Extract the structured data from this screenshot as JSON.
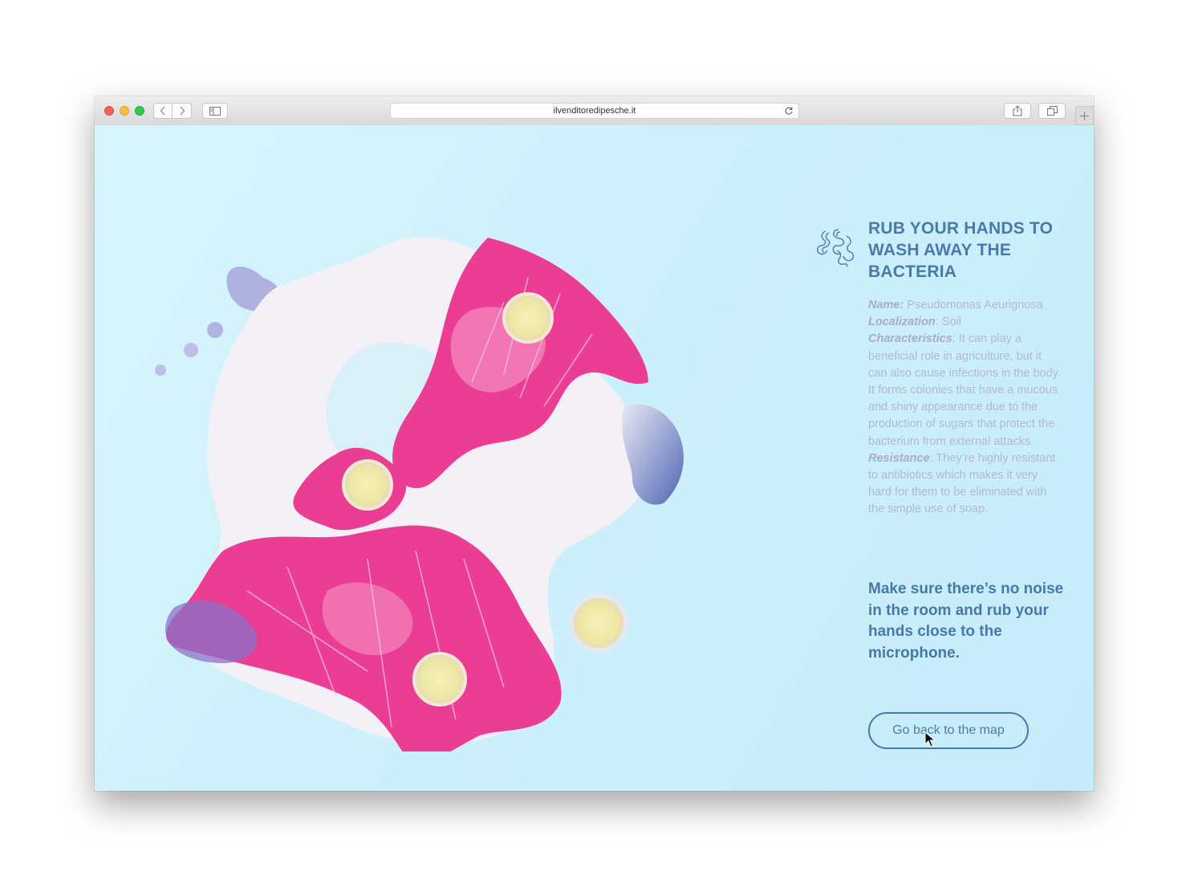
{
  "browser": {
    "url": "ilvenditoredipesche.it"
  },
  "page": {
    "title": "RUB YOUR HANDS TO WASH AWAY THE BACTERIA",
    "info": {
      "name_label": "Name:",
      "name_value": " Pseudomonas Aeurignosa",
      "localization_label": "Localization",
      "localization_value": ": Soil",
      "characteristics_label": "Characteristics",
      "characteristics_value": ": It can play a beneficial role in agriculture, but it can also cause infections in the body. It forms colonies that have a mucous and shiny appearance due to the production of sugars that protect the bacterium from external attacks.",
      "resistance_label": "Resistance",
      "resistance_value": ": They’re highly resistant to antibiotics which makes it very hard for them to be eliminated with the simple use of soap."
    },
    "instruction": "Make sure there’s no noise in the room and rub your hands close to the microphone.",
    "back_button_label": "Go back to the map"
  },
  "colors": {
    "background": "#cdeffa",
    "heading": "#4a7aa8",
    "body_text": "#b4b9c8",
    "bacteria_pink": "#ec3d94",
    "bacteria_white": "#f3f1f6",
    "bacteria_purple": "#a8a4d8"
  },
  "icons": {
    "bacteria": "bacteria-icon",
    "back": "chevron-left-icon",
    "forward": "chevron-right-icon",
    "sidebar": "sidebar-icon",
    "share": "share-icon",
    "tabs": "tabs-icon",
    "new_tab": "plus-icon",
    "reload": "reload-icon"
  }
}
